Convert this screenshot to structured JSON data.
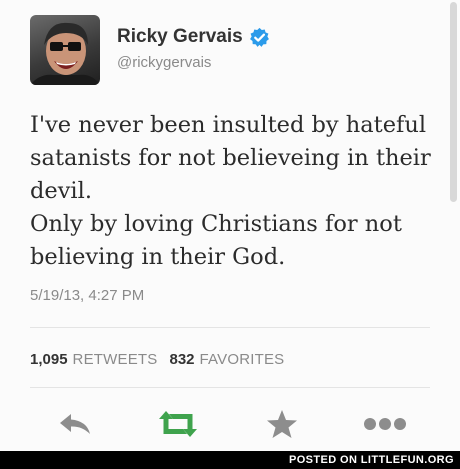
{
  "user": {
    "display_name": "Ricky Gervais",
    "handle": "@rickygervais",
    "verified_icon": "verified-badge-icon",
    "avatar_icon": "profile-photo"
  },
  "tweet": {
    "lines": [
      "I've never been insulted by hateful",
      "satanists for not believeing in their",
      "devil.",
      "Only by loving Christians for not",
      "believing in their God."
    ],
    "timestamp": "5/19/13, 4:27 PM"
  },
  "stats": {
    "retweets_count": "1,095",
    "retweets_label": "RETWEETS",
    "favorites_count": "832",
    "favorites_label": "FAVORITES"
  },
  "actions": [
    {
      "icon": "reply-icon"
    },
    {
      "icon": "retweet-icon"
    },
    {
      "icon": "favorite-star-icon"
    },
    {
      "icon": "more-dots-icon"
    }
  ],
  "colors": {
    "verified_blue": "#2b9bea",
    "retweet_green": "#3fa34d",
    "action_gray": "#8d8d8d",
    "text_dark": "#2b2b2b",
    "text_muted": "#8a8a8a"
  },
  "watermark": "POSTED ON LITTLEFUN.ORG"
}
